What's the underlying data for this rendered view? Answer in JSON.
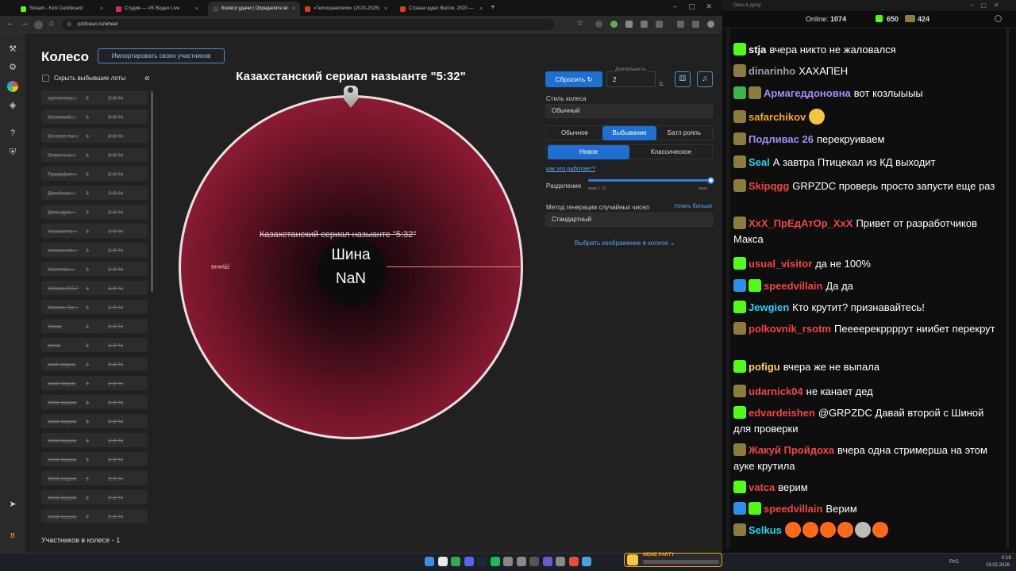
{
  "browser": {
    "tabs": [
      {
        "label": "Stream - Kick Dashboard",
        "color": "#53fc18"
      },
      {
        "label": "Студия — VK Видео Live",
        "color": "#e0245e"
      },
      {
        "label": "Колесо удачи | Определите вс",
        "color": "#444",
        "active": true
      },
      {
        "label": "«Телохранители» (2023-2025)",
        "color": "#d93d1b"
      },
      {
        "label": "Страна чудес Вилли, 2020 —",
        "color": "#d93d1b"
      }
    ],
    "url": "pzdcauc.ru/wheel",
    "new_tab": "+"
  },
  "page": {
    "title": "Колесо",
    "import_btn": "Импортировать своих участников",
    "hide_label": "Скрыть выбывшие лоты",
    "collapse": "«",
    "lots": [
      {
        "name": "артистка...",
        "qty": "1",
        "pct": "2.0 %"
      },
      {
        "name": "Великий...",
        "qty": "1",
        "pct": "2.0 %"
      },
      {
        "name": "Во всё тя...",
        "qty": "1",
        "pct": "2.0 %"
      },
      {
        "name": "Впритык...",
        "qty": "1",
        "pct": "2.0 %"
      },
      {
        "name": "Граффит...",
        "qty": "1",
        "pct": "2.0 %"
      },
      {
        "name": "Двойник...",
        "qty": "1",
        "pct": "2.0 %"
      },
      {
        "name": "Дом дра...",
        "qty": "1",
        "pct": "2.0 %"
      },
      {
        "name": "Казахста...",
        "qty": "1",
        "pct": "2.0 %"
      },
      {
        "name": "кокаинов...",
        "qty": "1",
        "pct": "2.0 %"
      },
      {
        "name": "Констан...",
        "qty": "1",
        "pct": "2.0 %"
      },
      {
        "name": "Мама 2017",
        "qty": "1",
        "pct": "2.0 %"
      },
      {
        "name": "Маска Зо...",
        "qty": "1",
        "pct": "2.0 %"
      },
      {
        "name": "Маяк",
        "qty": "1",
        "pct": "2.0 %"
      },
      {
        "name": "мгла",
        "qty": "1",
        "pct": "2.0 %"
      },
      {
        "name": "мой варик",
        "qty": "1",
        "pct": "2.0 %"
      },
      {
        "name": "мой варик",
        "qty": "1",
        "pct": "2.0 %"
      },
      {
        "name": "Мой варик",
        "qty": "1",
        "pct": "2.0 %"
      },
      {
        "name": "Мой варик",
        "qty": "1",
        "pct": "2.0 %"
      },
      {
        "name": "Мой варик",
        "qty": "1",
        "pct": "2.0 %"
      },
      {
        "name": "Мой варик",
        "qty": "1",
        "pct": "2.0 %"
      },
      {
        "name": "Мой варик",
        "qty": "1",
        "pct": "2.0 %"
      },
      {
        "name": "Мой варик",
        "qty": "1",
        "pct": "2.0 %"
      },
      {
        "name": "Мой варик",
        "qty": "1",
        "pct": "2.0 %"
      }
    ],
    "participants": "Участников в колесе - 1",
    "wheel_title": "Казахстанский сериал назыанте \"5:32\"",
    "wheel_label": "Казахстанский сериал назыанте \"5:32\"",
    "wheel_side": "вниШ",
    "center_name": "Шина",
    "center_value": "NaN",
    "reset_btn": "Сбросить",
    "duration_label": "Длительность",
    "duration_value": "2",
    "duration_unit": "с.",
    "style_label": "Стиль колеса",
    "style_value": "Обычный",
    "modes": [
      "Обычное",
      "Выбывание",
      "Батл рояль"
    ],
    "submodes": [
      "Новое",
      "Классическое"
    ],
    "how_link": "как это работает?",
    "split_label": "Разделение",
    "split_min": "макс / 10",
    "split_max": "макс",
    "split_level": 1.0,
    "rng_label": "Метод генерации случайных чисел",
    "rng_more": "Узнать больше",
    "rng_value": "Стандартный",
    "image_link": "Выбрать изображение в колесе"
  },
  "chat": {
    "window_title": "Окно в душу",
    "online_label": "Online:",
    "online_value": "1074",
    "kick_count": "650",
    "vk_count": "424",
    "messages": [
      {
        "badges": [
          "kick"
        ],
        "user": "stja",
        "color": "#ffffff",
        "text": "вчера никто не жаловался"
      },
      {
        "badges": [
          "crown"
        ],
        "user": "dinarinho",
        "color": "#9aa0a6",
        "text": "ХАХАПЕН"
      },
      {
        "badges": [
          "shield",
          "crown"
        ],
        "user": "Армагеддоновна",
        "color": "#a78bfa",
        "text": "вот козлыыыы"
      },
      {
        "badges": [
          "crown"
        ],
        "user": "safarchikov",
        "color": "#f5a623",
        "text": "",
        "emotes": 1
      },
      {
        "badges": [
          "crown"
        ],
        "user": "Подливас 26",
        "color": "#a78bfa",
        "text": "перекруиваем"
      },
      {
        "badges": [
          "crown"
        ],
        "user": "Seal",
        "color": "#22d3ee",
        "text": "А завтра Птицекал из КД выходит"
      },
      {
        "badges": [
          "crown"
        ],
        "user": "Skipqgg",
        "color": "#ef4444",
        "text": "GRPZDC проверь просто запусти еще раз"
      },
      {
        "badges": [
          "crown"
        ],
        "user": "XxX_ПрЕдАтОр_XxX",
        "color": "#ef4444",
        "text": "Привет от разработчиков Макса"
      },
      {
        "badges": [
          "kick"
        ],
        "user": "usual_visitor",
        "color": "#ef4444",
        "text": "да не 100%"
      },
      {
        "badges": [
          "sword",
          "kick"
        ],
        "user": "speedvillain",
        "color": "#ef4444",
        "text": "Да да"
      },
      {
        "badges": [
          "kick"
        ],
        "user": "Jewgien",
        "color": "#22d3ee",
        "text": "Кто крутит? признавайтесь!"
      },
      {
        "badges": [
          "crown"
        ],
        "user": "polkovnik_rsotm",
        "color": "#ef4444",
        "text": "Пеееерекррррут ниибет перекрут"
      },
      {
        "badges": [
          "kick"
        ],
        "user": "pofigu",
        "color": "#ffd54a",
        "text": "вчера же не выпала"
      },
      {
        "badges": [
          "crown"
        ],
        "user": "udarnick04",
        "color": "#ef4444",
        "text": "не канает дед"
      },
      {
        "badges": [
          "kick"
        ],
        "user": "edvardeishen",
        "color": "#ef4444",
        "text": "@GRPZDC Давай второй с Шиной для проверки"
      },
      {
        "badges": [
          "crown"
        ],
        "user": "Жакуй Пройдоха",
        "color": "#ef4444",
        "text": "вчера одна стримерша на этом ауке крутила"
      },
      {
        "badges": [
          "kick"
        ],
        "user": "vatca",
        "color": "#ef4444",
        "text": "верим"
      },
      {
        "badges": [
          "sword",
          "kick"
        ],
        "user": "speedvillain",
        "color": "#ef4444",
        "text": "Верим"
      },
      {
        "badges": [
          "crown"
        ],
        "user": "Selkus",
        "color": "#22d3ee",
        "text": "",
        "emotes": 6
      }
    ]
  },
  "taskbar": {
    "lang": "РУС",
    "time": "0:19",
    "date": "19.02.2026",
    "meme_label": "MEME PARTY"
  }
}
